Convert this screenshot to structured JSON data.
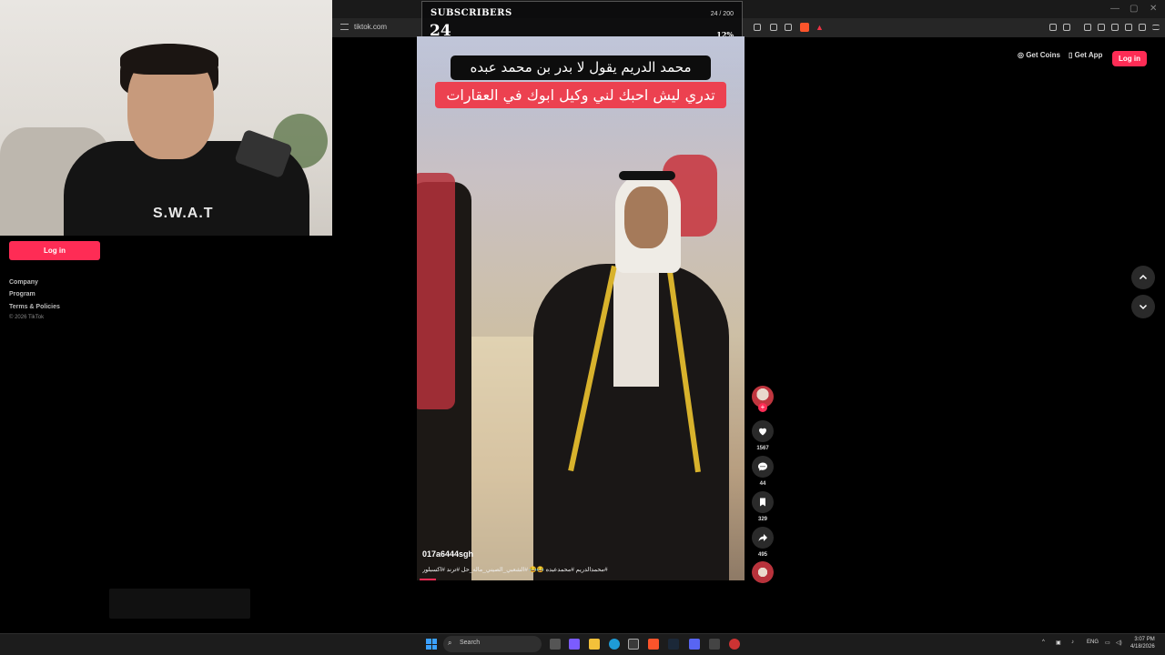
{
  "webcam": {
    "shirt_text": "S.W.A.T"
  },
  "browser": {
    "url": "tiktok.com",
    "window_controls": [
      "—",
      "▢",
      "✕"
    ]
  },
  "subscriber_goal": {
    "label": "SUBSCRIBERS",
    "count": "24",
    "ratio": "24 / 200",
    "percent_text": "12%",
    "progress": 0.12
  },
  "tiktok_header": {
    "get_coins": "Get Coins",
    "get_app": "Get App",
    "login": "Log in"
  },
  "sidebar": {
    "login": "Log in",
    "links": [
      "Company",
      "Program",
      "Terms & Policies"
    ],
    "copyright": "© 2026 TikTok"
  },
  "video": {
    "caption_line1": "محمد الدريم يقول لا بدر بن محمد عبده",
    "caption_line2": "تدري ليش احبك لني وكيل ابوك في العقارات",
    "username": "017a6444sgh",
    "hashtags": "#محمدالدريم #محمدعبده 😂😂 #الشعبي_الصيني_ماله_حل #ترند #اكسبلور"
  },
  "actions": {
    "likes": "1567",
    "comments": "44",
    "saves": "329",
    "shares": "495"
  },
  "taskbar": {
    "search": "Search",
    "lang": "ENG",
    "time": "3:07 PM",
    "date": "4/18/2026"
  },
  "colors": {
    "tiktok_red": "#fe2c55",
    "caption_red": "#ec4150"
  }
}
